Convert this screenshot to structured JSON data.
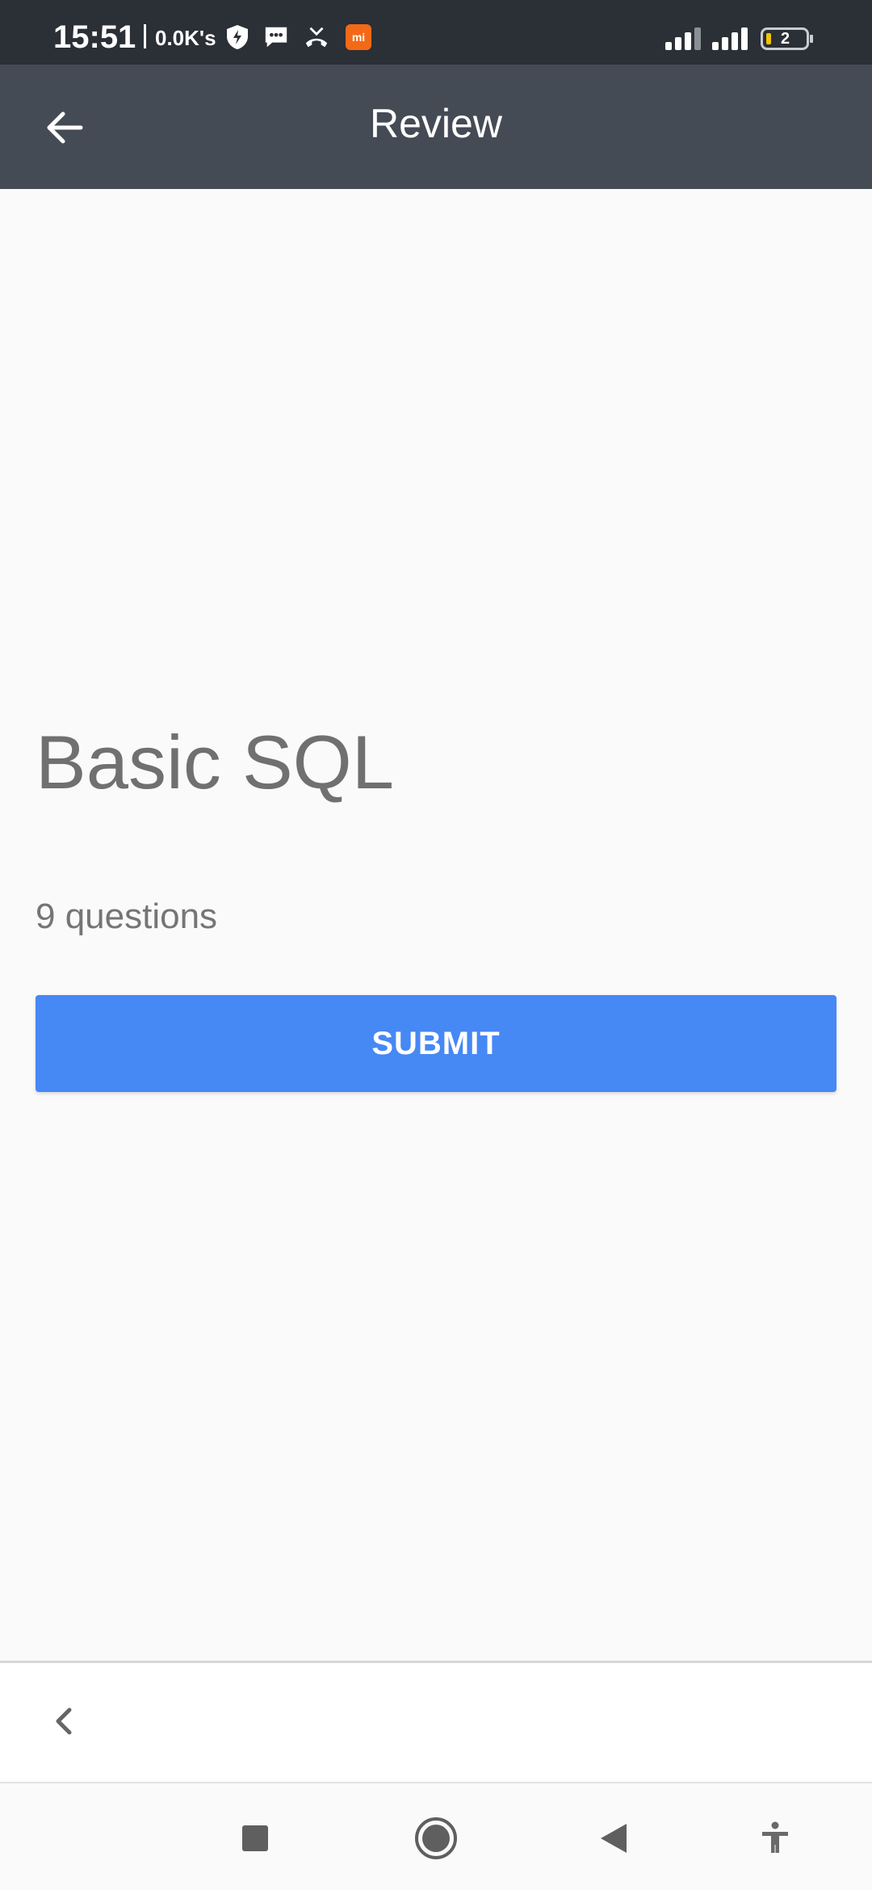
{
  "status_bar": {
    "time": "15:51",
    "network_speed": "0.0K's",
    "icons": [
      "shield-bolt-icon",
      "message-icon",
      "missed-call-icon",
      "mi-app-icon",
      "signal-icon",
      "signal-icon",
      "battery-icon"
    ],
    "battery_level": "2",
    "mi_badge": "mi"
  },
  "app_bar": {
    "title": "Review",
    "back_icon": "arrow-left-icon"
  },
  "main": {
    "quiz_title": "Basic SQL",
    "question_count": "9 questions",
    "submit_label": "SUBMIT"
  },
  "bottom_bar": {
    "back_icon": "chevron-left-icon"
  },
  "nav_bar": {
    "icons": [
      "recents-square-icon",
      "home-circle-icon",
      "back-triangle-icon",
      "accessibility-icon"
    ]
  },
  "colors": {
    "status_bar_bg": "#2b2f36",
    "app_bar_bg": "#454b55",
    "accent": "#4688f4",
    "page_bg": "#fafafa"
  }
}
